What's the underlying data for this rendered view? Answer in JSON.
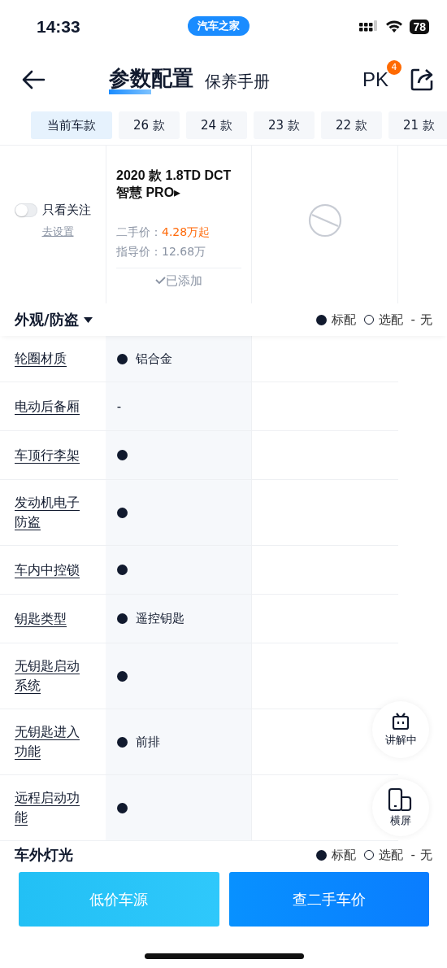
{
  "status_bar": {
    "time": "14:33",
    "app": "汽车之家",
    "battery": "78"
  },
  "header": {
    "tabs": [
      {
        "label": "参数配置",
        "selected": true
      },
      {
        "label": "保养手册",
        "selected": false
      }
    ],
    "pk": "PK",
    "pk_badge": "4"
  },
  "year_tabs": [
    {
      "label": "当前车款",
      "selected": true
    },
    {
      "label": "26 款",
      "selected": false
    },
    {
      "label": "24 款",
      "selected": false
    },
    {
      "label": "23 款",
      "selected": false
    },
    {
      "label": "22 款",
      "selected": false
    },
    {
      "label": "21 款",
      "selected": false
    }
  ],
  "filter": {
    "label": "只看关注",
    "on": false,
    "link": "去设置"
  },
  "car": {
    "name": "2020 款 1.8TD DCT 智慧 PRO▸",
    "used_label": "二手价：",
    "used_price": "4.28万起",
    "guide_label": "指导价：",
    "guide_price": "12.68万",
    "added": "已添加"
  },
  "sections": [
    {
      "title": "外观/防盗",
      "legend": [
        {
          "kind": "standard",
          "text": "标配"
        },
        {
          "kind": "optional",
          "text": "选配"
        },
        {
          "kind": "none",
          "symbol": "-",
          "text": "无"
        }
      ],
      "rows": [
        {
          "label": "轮圈材质",
          "kind": "standard",
          "text": "铝合金"
        },
        {
          "label": "电动后备厢",
          "kind": "plain",
          "text": "-"
        },
        {
          "label": "车顶行李架",
          "kind": "standard"
        },
        {
          "label": "发动机电子防盗",
          "kind": "standard"
        },
        {
          "label": "车内中控锁",
          "kind": "standard"
        },
        {
          "label": "钥匙类型",
          "kind": "standard",
          "text": "遥控钥匙"
        },
        {
          "label": "无钥匙启动系统",
          "kind": "standard"
        },
        {
          "label": "无钥匙进入功能",
          "kind": "standard",
          "text": "前排"
        },
        {
          "label": "远程启动功能",
          "kind": "standard"
        }
      ]
    },
    {
      "title": "车外灯光",
      "legend": [
        {
          "kind": "standard",
          "text": "标配"
        },
        {
          "kind": "optional",
          "text": "选配"
        },
        {
          "kind": "none",
          "symbol": "-",
          "text": "无"
        }
      ]
    }
  ],
  "floating": [
    {
      "kind": "tv",
      "label": "讲解中"
    },
    {
      "kind": "rotate",
      "label": "横屏"
    }
  ],
  "buttons": [
    {
      "kind": "light",
      "label": "低价车源"
    },
    {
      "kind": "dark",
      "label": "查二手车价"
    }
  ]
}
